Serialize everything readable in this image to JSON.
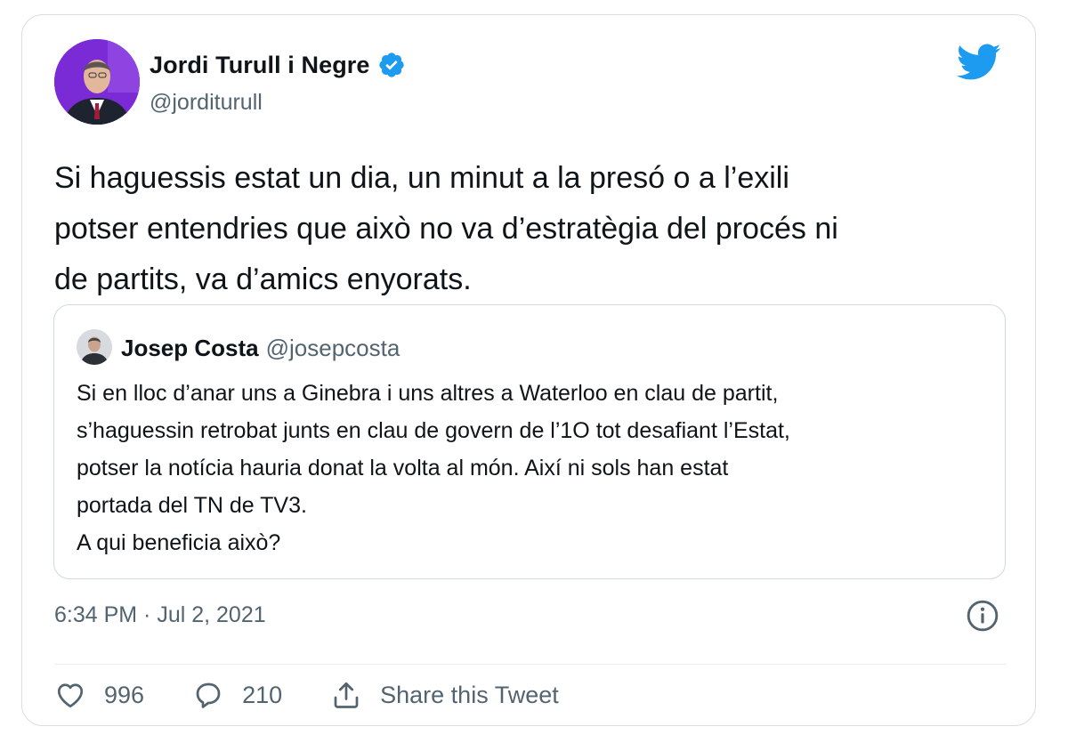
{
  "tweet": {
    "author": {
      "name": "Jordi Turull i Negre",
      "handle": "@jorditurull",
      "verified_icon": "verified-badge-icon",
      "avatar_bg": "#7b2bd6"
    },
    "brand_icon": "twitter-bird-icon",
    "brand_color": "#1d9bf0",
    "text": "Si haguessis estat un dia, un minut a la presó o a l’exili\npotser entendries que això no va d’estratègia del procés ni\nde partits, va d’amics enyorats.",
    "quote": {
      "author_name": "Josep Costa",
      "author_handle": "@josepcosta",
      "text": "Si en lloc d’anar uns a Ginebra i uns altres a Waterloo en clau de partit,\ns’haguessin retrobat junts en clau de govern de l’1O tot desafiant l’Estat,\npotser la notícia hauria donat la volta al món. Així ni sols han estat\nportada del TN de TV3.\nA qui beneficia això?"
    },
    "timestamp": "6:34 PM · Jul 2, 2021",
    "info_icon": "info-icon",
    "actions": {
      "like_count": "996",
      "reply_count": "210",
      "share_label": "Share this Tweet"
    }
  }
}
